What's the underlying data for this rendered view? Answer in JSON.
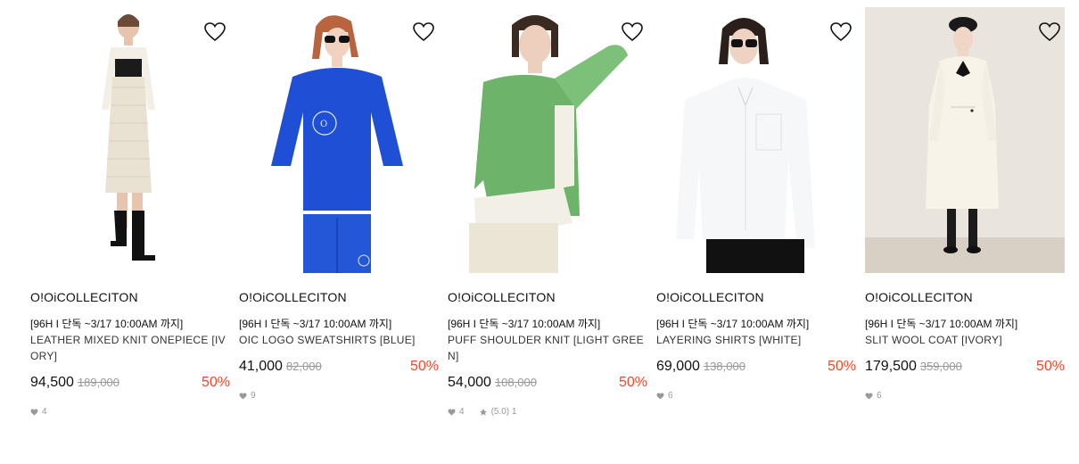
{
  "products": [
    {
      "brand": "O!OiCOLLECITON",
      "promo": "[96H I 단독 ~3/17 10:00AM 까지]",
      "name": "LEATHER MIXED KNIT ONEPIECE [IVORY]",
      "price": "94,500",
      "original_price": "189,000",
      "discount": "50%",
      "likes": "4",
      "rating": ""
    },
    {
      "brand": "O!OiCOLLECITON",
      "promo": "[96H I 단독 ~3/17 10:00AM 까지]",
      "name": "OIC LOGO SWEATSHIRTS [BLUE]",
      "price": "41,000",
      "original_price": "82,000",
      "discount": "50%",
      "likes": "9",
      "rating": ""
    },
    {
      "brand": "O!OiCOLLECITON",
      "promo": "[96H I 단독 ~3/17 10:00AM 까지]",
      "name": "PUFF SHOULDER KNIT [LIGHT GREEN]",
      "price": "54,000",
      "original_price": "108,000",
      "discount": "50%",
      "likes": "4",
      "rating": "(5.0) 1"
    },
    {
      "brand": "O!OiCOLLECITON",
      "promo": "[96H I 단독 ~3/17 10:00AM 까지]",
      "name": "LAYERING SHIRTS [WHITE]",
      "price": "69,000",
      "original_price": "138,000",
      "discount": "50%",
      "likes": "6",
      "rating": ""
    },
    {
      "brand": "O!OiCOLLECITON",
      "promo": "[96H I 단독 ~3/17 10:00AM 까지]",
      "name": "SLIT WOOL COAT [IVORY]",
      "price": "179,500",
      "original_price": "359,000",
      "discount": "50%",
      "likes": "6",
      "rating": ""
    }
  ],
  "colors": {
    "discount": "#f04a2a",
    "muted": "#999999"
  },
  "icons": {
    "wishlist": "heart-outline-icon",
    "likes": "heart-filled-icon",
    "rating": "star-icon"
  }
}
